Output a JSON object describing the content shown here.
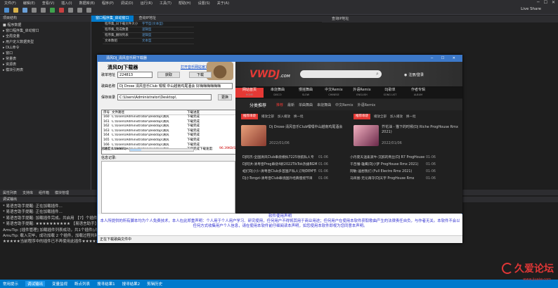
{
  "ide": {
    "menu": [
      "文件(F)",
      "编辑(E)",
      "查看(V)",
      "插入(I)",
      "数据库(B)",
      "程序(P)",
      "调试(D)",
      "运行(R)",
      "工具(T)",
      "帮助(H)",
      "设置(S)",
      "关于(A)"
    ],
    "live_share": "Live Share",
    "tabs": [
      {
        "label": "窗口程序集_启动窗口",
        "active": true
      },
      {
        "label": "查询IP地址",
        "active": false
      }
    ],
    "left_panel_title": "项目结构",
    "tree": [
      "■ 程序数据",
      "▸ 窗口程序集_启动窗口",
      "▸ 全局变量",
      "▸ 用户定义数据类型",
      "▸ DLL命令",
      "▸ 窗口",
      "▸ 常量表",
      "▸ 资源表",
      "▸ 模块引用表"
    ],
    "props": [
      {
        "k": "程序集_日下载文件大小",
        "v": "字节型(文本型)"
      },
      {
        "k": "程序集_完成数量",
        "v": "逻辑型"
      },
      {
        "k": "程序集_删除列表",
        "v": "逻辑型"
      },
      {
        "k": "文本数组",
        "v": "文本型"
      }
    ],
    "right_panel_title": "查询IP地址",
    "bottom_tabs": [
      "属性列表",
      "支持库",
      "组件箱",
      "模块管理"
    ],
    "debug_title": "调试输出",
    "debug_lines": [
      "* 易语言助手提醒: 正在加载插件...",
      "* 易语言助手提醒: 正在加载插件...",
      "* 易语言助手提醒: 加载插件完成。共启用 【7】个插件！",
      "* 易语言助手提醒: ★★★★★★★★★★ 【易语言助手】 ★★★★★★★★★★",
      "AmuTip: [插件管理] 加载插件列表成功，共1个插件(占用)",
      "AmuTip: 载入完毕，成功加载 2 个插件，加载过程共耗时: 125ms.",
      "★★★★★当前程序中的插件已不再使用此插件★★★★★"
    ],
    "status_tabs": [
      {
        "label": "常用提示",
        "active": false
      },
      {
        "label": "调试输出",
        "active": true
      },
      {
        "label": "变量监视",
        "active": false
      },
      {
        "label": "断点列表",
        "active": false
      },
      {
        "label": "搜寻结果1",
        "active": false
      },
      {
        "label": "搜寻结果2",
        "active": false
      },
      {
        "label": "剪辑历史",
        "active": false
      }
    ]
  },
  "dialog": {
    "title": "清风DJ_清风音乐网下载器",
    "app_name": "清风DJ下载器",
    "link": "打开音乐网站官方网站",
    "url_label": "歌单地址",
    "url_value": "224813",
    "get_button": "获取",
    "download_button": "下载",
    "song_label": "歌曲名称",
    "song_value": "Dj Drose 清风音乐Club 嘿嘿 中山越南鸡尾酒会 好嗨嗨嗨嗨嗨嗨",
    "dir_label": "保存目录",
    "dir_value": "C:\\Users\\Administrator\\Desktop\\",
    "browse_button": "更换",
    "columns": [
      "序号",
      "文件路径",
      "下载进度"
    ],
    "rows": [
      {
        "n": "160",
        "p": "C:\\Users\\Administrator\\Desktop\\清风",
        "s": "下载完成"
      },
      {
        "n": "161",
        "p": "C:\\Users\\Administrator\\Desktop\\清风",
        "s": "下载完成"
      },
      {
        "n": "162",
        "p": "C:\\Users\\Administrator\\Desktop\\清风",
        "s": "下载完成"
      },
      {
        "n": "163",
        "p": "C:\\Users\\Administrator\\Desktop\\清风",
        "s": "下载完成"
      },
      {
        "n": "164",
        "p": "C:\\Users\\Administrator\\Desktop\\清风",
        "s": "下载完成"
      },
      {
        "n": "165",
        "p": "C:\\Users\\Administrator\\Desktop\\清风",
        "s": "下载完成"
      },
      {
        "n": "166",
        "p": "C:\\Users\\Administrator\\Desktop\\清风",
        "s": "下载完成"
      },
      {
        "n": "167",
        "p": "C:\\Users\\Administrator\\Desktop\\清风",
        "s": "下载完成"
      }
    ],
    "progress_label": "总进度(169/961)",
    "progress": 0.18,
    "speed_label": "下载速度:",
    "speed_value": "96.39KB/S",
    "info_label": "信息记录:",
    "notice_title": "软件使用声明",
    "notice_text": "本人所提供的所有脚本均为个人免费技术，本人在此郑重声明：个人用于个人用户学习、研究使用，任何用户不得将其用于商业用途；任何用户在使用本软件获取歌曲产生的法律责任自负，与作者无关。本软件不会以任何方式收集用户个人信息，请在使用本软件前仔细阅读本声明，如您使用本软件即视为您同意本声明。",
    "status": "正在下载歌曲文件中"
  },
  "site": {
    "logo_a": "VWDJ",
    "logo_b": ".COM",
    "login": "注册/登录",
    "nav": [
      {
        "label": "网站首页",
        "sub": "HOME",
        "active": true
      },
      {
        "label": "串烧舞曲",
        "sub": "DISCO",
        "active": false
      },
      {
        "label": "慢摇舞曲",
        "sub": "SLOW",
        "active": false
      },
      {
        "label": "中文Remix",
        "sub": "CHINESE",
        "active": false
      },
      {
        "label": "外语Remix",
        "sub": "ENGLISH",
        "active": false
      },
      {
        "label": "DJ歌单",
        "sub": "SONG LIST",
        "active": false
      },
      {
        "label": "作者专辑",
        "sub": "ALBUM",
        "active": false
      }
    ],
    "cat_head": "分类推荐",
    "cats": [
      {
        "label": "推荐",
        "on": true
      },
      {
        "label": "最新",
        "on": false
      },
      {
        "label": "单曲舞曲",
        "on": false
      },
      {
        "label": "串烧舞曲",
        "on": false
      },
      {
        "label": "中文Remix",
        "on": false
      },
      {
        "label": "外语Remix",
        "on": false
      }
    ],
    "card_tag": "推荐串烧",
    "card_actions": [
      "播放全部",
      "加入播放",
      "换一批"
    ],
    "card1_title": "Dj Drose-清风音乐Club嘿嘿中山越南鸡尾酒会",
    "card1_date": "2022/01/06",
    "card2_title": "芥花油 - 猫下的时候(DJ Riche ProgHouse Rmx 2021)",
    "card2_date": "2022/01/06",
    "songs": [
      {
        "a": "DJ阿杰-全国清风Club串烧模拟7225领航私人专",
        "d": "01-06",
        "b": "小丹夏天温柔滚牛-沉醉的青丝(DJ R7 ProgHouse",
        "e": "01-06"
      },
      {
        "a": "DJ阿洪-清粤音Prog串烧4新2022TikTok热播BGM",
        "d": "01-06",
        "b": "千百懂-雄鹰(DJ小梦 ProgHouse Rmx 2021)",
        "e": "01-06"
      },
      {
        "a": "蛙们DJ小少-清粤音Club多首国产私人订制DEM节",
        "d": "01-06",
        "b": "阿敏-遥想我们 (Full Electro Rmx 2021)",
        "e": "01-06"
      },
      {
        "a": "DJ小Tongzi-清粤音Club串烧国外经典慢摇节目",
        "d": "01-06",
        "b": "马目宸-无论再守(DJ天宇 ProgHouse Rmx",
        "e": "01-06"
      }
    ]
  },
  "watermark": {
    "text": "久爱论坛",
    "url": "www.jiuaiw.com"
  }
}
